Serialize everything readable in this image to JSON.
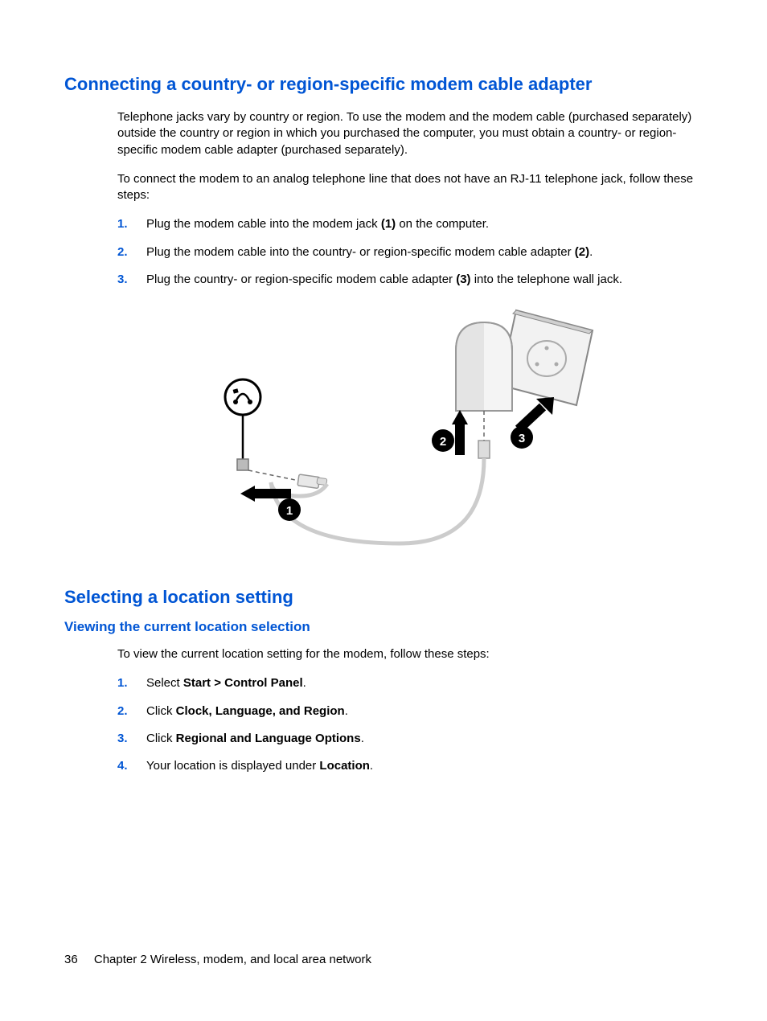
{
  "headings": {
    "h1": "Connecting a country- or region-specific modem cable adapter",
    "h2": "Selecting a location setting",
    "h3": "Viewing the current location selection"
  },
  "intro": {
    "p1": "Telephone jacks vary by country or region. To use the modem and the modem cable (purchased separately) outside the country or region in which you purchased the computer, you must obtain a country- or region-specific modem cable adapter (purchased separately).",
    "p2": "To connect the modem to an analog telephone line that does not have an RJ-11 telephone jack, follow these steps:"
  },
  "steps1": [
    {
      "num": "1.",
      "before": "Plug the modem cable into the modem jack ",
      "bold": "(1)",
      "after": " on the computer."
    },
    {
      "num": "2.",
      "before": "Plug the modem cable into the country- or region-specific modem cable adapter ",
      "bold": "(2)",
      "after": "."
    },
    {
      "num": "3.",
      "before": "Plug the country- or region-specific modem cable adapter ",
      "bold": "(3)",
      "after": " into the telephone wall jack."
    }
  ],
  "location_intro": "To view the current location setting for the modem, follow these steps:",
  "steps2": [
    {
      "num": "1.",
      "before": "Select ",
      "bold": "Start > Control Panel",
      "after": "."
    },
    {
      "num": "2.",
      "before": "Click ",
      "bold": "Clock, Language, and Region",
      "after": "."
    },
    {
      "num": "3.",
      "before": "Click ",
      "bold": "Regional and Language Options",
      "after": "."
    },
    {
      "num": "4.",
      "before": "Your location is displayed under ",
      "bold": "Location",
      "after": "."
    }
  ],
  "footer": {
    "page": "36",
    "chapter": "Chapter 2   Wireless, modem, and local area network"
  },
  "figure_labels": {
    "one": "1",
    "two": "2",
    "three": "3"
  }
}
